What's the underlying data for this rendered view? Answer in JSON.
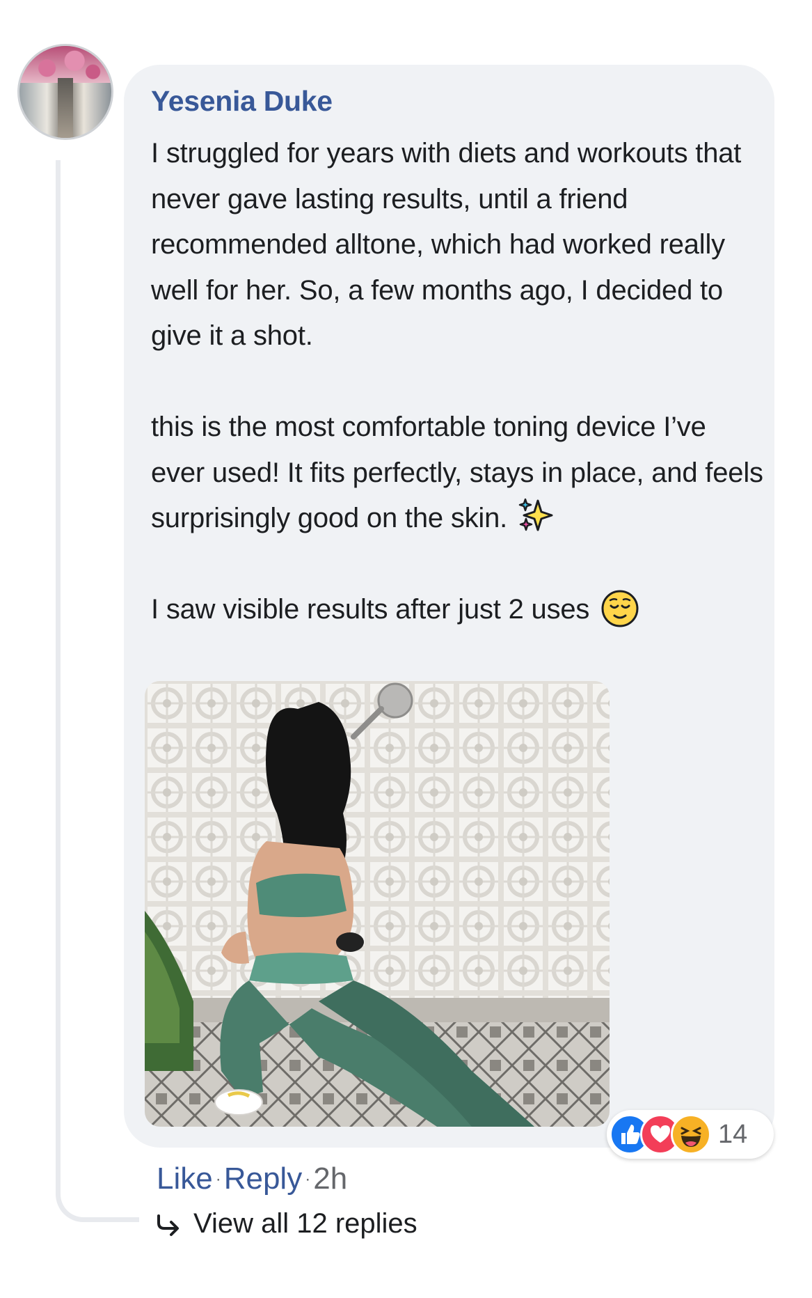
{
  "comment": {
    "author": "Yesenia Duke",
    "paragraphs": [
      "I struggled for years with diets and workouts that never gave lasting results, until a friend recommended alltone, which had worked really well for her. So, a few months ago, I decided to give it a shot.",
      "this is the most comfortable toning device I’ve ever used! It fits perfectly, stays in place, and feels surprisingly good on the skin.",
      "I saw visible results after just 2 uses"
    ],
    "emojis": [
      "sparkles-emoji",
      "relieved-face-emoji"
    ],
    "reactions": {
      "icons": [
        "like-icon",
        "love-icon",
        "haha-icon"
      ],
      "count": "14"
    },
    "actions": {
      "like": "Like",
      "reply": "Reply",
      "separator": "·",
      "time": "2h"
    },
    "view_replies": "View all 12 replies"
  },
  "colors": {
    "bubble": "#f0f2f5",
    "author": "#385898",
    "text": "#1c1e21",
    "meta": "#65676b",
    "like": "#1877f2",
    "love": "#f33e58",
    "haha": "#f7b125"
  }
}
